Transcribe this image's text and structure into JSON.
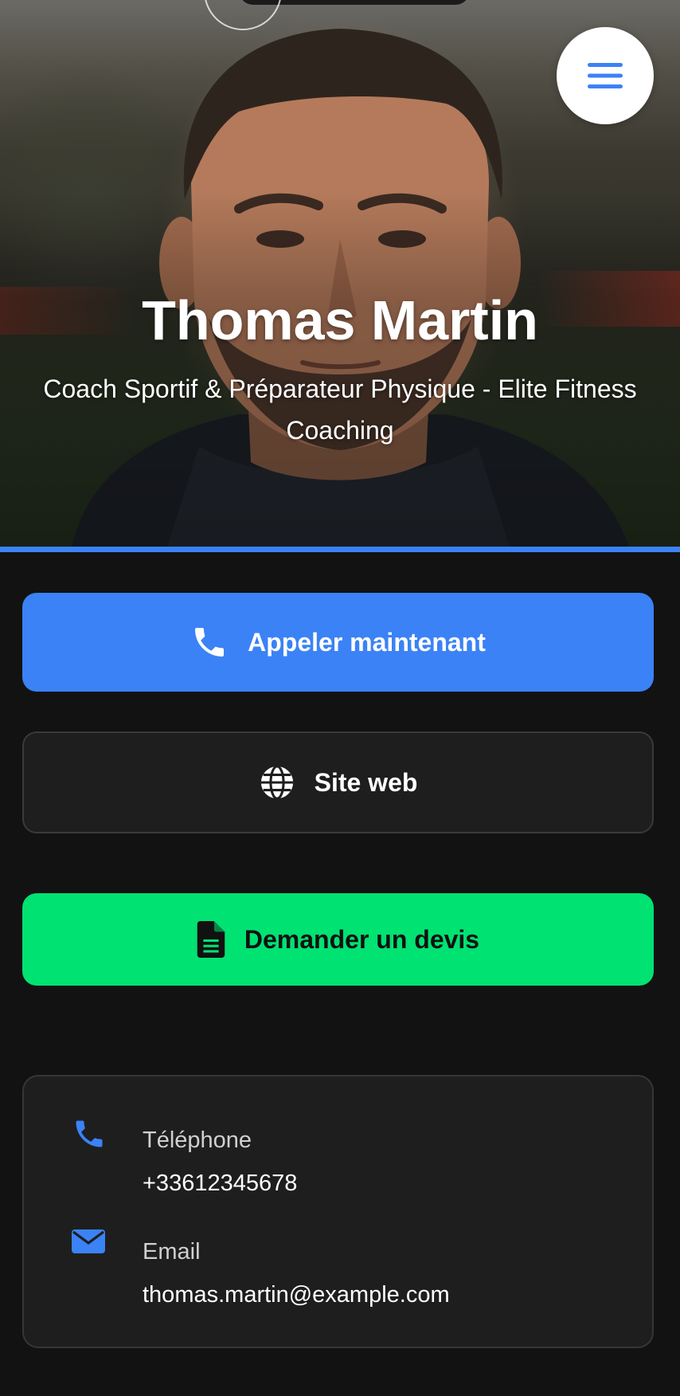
{
  "profile": {
    "name": "Thomas Martin",
    "subtitle": "Coach Sportif & Préparateur Physique - Elite Fitness Coaching"
  },
  "actions": {
    "call_label": "Appeler maintenant",
    "website_label": "Site web",
    "quote_label": "Demander un devis"
  },
  "contact": {
    "phone_label": "Téléphone",
    "phone_value": "+33612345678",
    "email_label": "Email",
    "email_value": "thomas.martin@example.com"
  },
  "icons": {
    "menu": "hamburger-menu-icon",
    "call": "phone-icon",
    "website": "globe-icon",
    "quote": "document-icon",
    "contact_phone": "phone-icon",
    "contact_email": "envelope-icon"
  },
  "colors": {
    "accent_blue": "#3b82f6",
    "accent_green": "#00e272",
    "background": "#121212",
    "card": "#1e1e1e"
  }
}
